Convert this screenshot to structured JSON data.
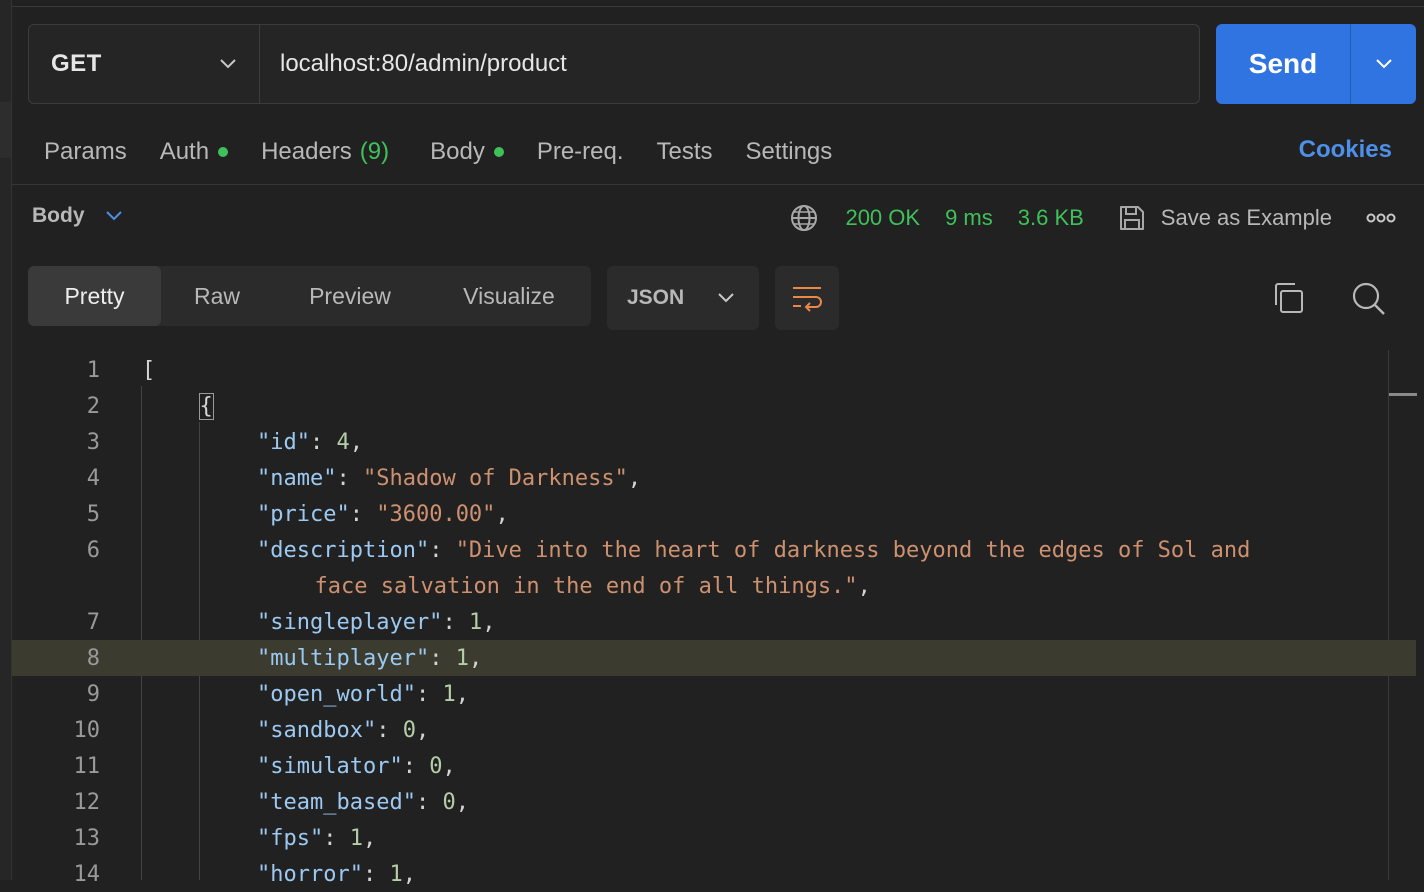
{
  "request": {
    "method": "GET",
    "url": "localhost:80/admin/product",
    "send_label": "Send"
  },
  "request_tabs": [
    {
      "label": "Params"
    },
    {
      "label": "Auth",
      "dot": true
    },
    {
      "label": "Headers",
      "count": "(9)"
    },
    {
      "label": "Body",
      "dot": true
    },
    {
      "label": "Pre-req."
    },
    {
      "label": "Tests"
    },
    {
      "label": "Settings"
    }
  ],
  "cookies_label": "Cookies",
  "response": {
    "section_label": "Body",
    "status": "200 OK",
    "time": "9 ms",
    "size": "3.6 KB",
    "save_example_label": "Save as Example"
  },
  "view_tabs": [
    "Pretty",
    "Raw",
    "Preview",
    "Visualize"
  ],
  "active_view": "Pretty",
  "format": "JSON",
  "colors": {
    "accent": "#2f74e0",
    "status_green": "#3fc15a",
    "key": "#9cc9f2",
    "string": "#ce9170",
    "number": "#b5cea8"
  },
  "icons": [
    "chevron-down-icon",
    "globe-icon",
    "save-icon",
    "more-icon",
    "wrap-icon",
    "copy-icon",
    "search-icon"
  ],
  "code_lines": [
    {
      "n": "1",
      "indent": 0,
      "tokens": [
        [
          "p",
          "["
        ]
      ]
    },
    {
      "n": "2",
      "indent": 1,
      "tokens": [
        [
          "brace",
          "{"
        ]
      ]
    },
    {
      "n": "3",
      "indent": 2,
      "tokens": [
        [
          "k",
          "\"id\""
        ],
        [
          "p",
          ": "
        ],
        [
          "n",
          "4"
        ],
        [
          "p",
          ","
        ]
      ]
    },
    {
      "n": "4",
      "indent": 2,
      "tokens": [
        [
          "k",
          "\"name\""
        ],
        [
          "p",
          ": "
        ],
        [
          "s",
          "\"Shadow of Darkness\""
        ],
        [
          "p",
          ","
        ]
      ]
    },
    {
      "n": "5",
      "indent": 2,
      "tokens": [
        [
          "k",
          "\"price\""
        ],
        [
          "p",
          ": "
        ],
        [
          "s",
          "\"3600.00\""
        ],
        [
          "p",
          ","
        ]
      ]
    },
    {
      "n": "6",
      "indent": 2,
      "tokens": [
        [
          "k",
          "\"description\""
        ],
        [
          "p",
          ": "
        ],
        [
          "s",
          "\"Dive into the heart of darkness beyond the edges of Sol and"
        ]
      ]
    },
    {
      "n": "",
      "indent": 3,
      "tokens": [
        [
          "s",
          "face salvation in the end of all things.\""
        ],
        [
          "p",
          ","
        ]
      ]
    },
    {
      "n": "7",
      "indent": 2,
      "tokens": [
        [
          "k",
          "\"singleplayer\""
        ],
        [
          "p",
          ": "
        ],
        [
          "n",
          "1"
        ],
        [
          "p",
          ","
        ]
      ]
    },
    {
      "n": "8",
      "indent": 2,
      "highlight": true,
      "tokens": [
        [
          "k",
          "\"multiplayer\""
        ],
        [
          "p",
          ": "
        ],
        [
          "n",
          "1"
        ],
        [
          "p",
          ","
        ]
      ]
    },
    {
      "n": "9",
      "indent": 2,
      "tokens": [
        [
          "k",
          "\"open_world\""
        ],
        [
          "p",
          ": "
        ],
        [
          "n",
          "1"
        ],
        [
          "p",
          ","
        ]
      ]
    },
    {
      "n": "10",
      "indent": 2,
      "tokens": [
        [
          "k",
          "\"sandbox\""
        ],
        [
          "p",
          ": "
        ],
        [
          "n",
          "0"
        ],
        [
          "p",
          ","
        ]
      ]
    },
    {
      "n": "11",
      "indent": 2,
      "tokens": [
        [
          "k",
          "\"simulator\""
        ],
        [
          "p",
          ": "
        ],
        [
          "n",
          "0"
        ],
        [
          "p",
          ","
        ]
      ]
    },
    {
      "n": "12",
      "indent": 2,
      "tokens": [
        [
          "k",
          "\"team_based\""
        ],
        [
          "p",
          ": "
        ],
        [
          "n",
          "0"
        ],
        [
          "p",
          ","
        ]
      ]
    },
    {
      "n": "13",
      "indent": 2,
      "tokens": [
        [
          "k",
          "\"fps\""
        ],
        [
          "p",
          ": "
        ],
        [
          "n",
          "1"
        ],
        [
          "p",
          ","
        ]
      ]
    },
    {
      "n": "14",
      "indent": 2,
      "tokens": [
        [
          "k",
          "\"horror\""
        ],
        [
          "p",
          ": "
        ],
        [
          "n",
          "1"
        ],
        [
          "p",
          ","
        ]
      ]
    }
  ]
}
